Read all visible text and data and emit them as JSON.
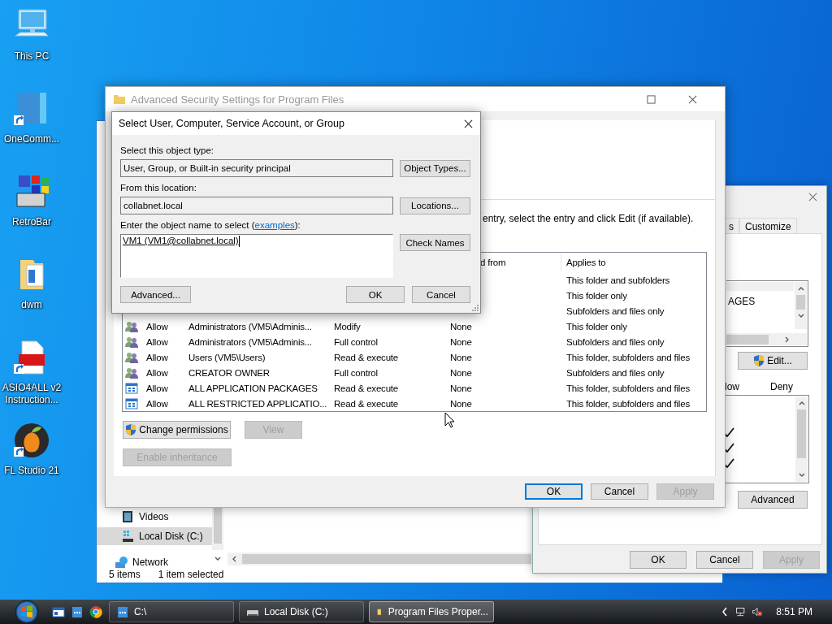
{
  "desktop_icons": [
    {
      "label": "This PC",
      "kind": "pc",
      "shortcut": false
    },
    {
      "label": "OneComm...",
      "kind": "one",
      "shortcut": true
    },
    {
      "label": "RetroBar",
      "kind": "retrobar",
      "shortcut": false
    },
    {
      "label": "dwm",
      "kind": "folder",
      "shortcut": false
    },
    {
      "label": "ASIO4ALL v2 Instruction...",
      "kind": "pdf",
      "shortcut": true
    },
    {
      "label": "FL Studio 21",
      "kind": "fl",
      "shortcut": true
    }
  ],
  "explorer": {
    "nav_items": [
      {
        "label": "Videos",
        "kind": "videos",
        "selected": false
      },
      {
        "label": "Local Disk (C:)",
        "kind": "disk",
        "selected": true
      },
      {
        "label": "Network",
        "kind": "network",
        "selected": false
      }
    ],
    "item_count": "5 items",
    "selection": "1 item selected"
  },
  "properties": {
    "tabs": [
      {
        "label": "s",
        "selected": false
      },
      {
        "label": "Customize",
        "selected": false
      }
    ],
    "group_item": "AGES",
    "edit_button": "Edit...",
    "permission_headers": {
      "allow": "low",
      "deny": "Deny"
    },
    "allow_checks": [
      {
        "checked": true
      },
      {
        "checked": true
      },
      {
        "checked": true
      }
    ],
    "advanced_button": "Advanced",
    "buttons": [
      {
        "label": "OK",
        "disabled": false
      },
      {
        "label": "Cancel",
        "disabled": false
      },
      {
        "label": "Apply",
        "disabled": true
      }
    ]
  },
  "advanced_security": {
    "title": "Advanced Security Settings for Program Files",
    "instruction": "entry, select the entry and click Edit (if available).",
    "headers": {
      "inherited": "d from",
      "applies_to": "Applies to"
    },
    "rows": [
      {
        "applies_to": "This folder and subfolders"
      },
      {
        "applies_to": "This folder only"
      },
      {
        "applies_to": "Subfolders and files only"
      },
      {
        "kind": "group",
        "type": "Allow",
        "principal": "Administrators (VM5\\Adminis...",
        "access": "Modify",
        "inherited": "None",
        "applies_to": "This folder only"
      },
      {
        "kind": "group",
        "type": "Allow",
        "principal": "Administrators (VM5\\Adminis...",
        "access": "Full control",
        "inherited": "None",
        "applies_to": "Subfolders and files only"
      },
      {
        "kind": "group",
        "type": "Allow",
        "principal": "Users (VM5\\Users)",
        "access": "Read & execute",
        "inherited": "None",
        "applies_to": "This folder, subfolders and files"
      },
      {
        "kind": "group",
        "type": "Allow",
        "principal": "CREATOR OWNER",
        "access": "Full control",
        "inherited": "None",
        "applies_to": "Subfolders and files only"
      },
      {
        "kind": "package",
        "type": "Allow",
        "principal": "ALL APPLICATION PACKAGES",
        "access": "Read & execute",
        "inherited": "None",
        "applies_to": "This folder, subfolders and files"
      },
      {
        "kind": "package",
        "type": "Allow",
        "principal": "ALL RESTRICTED APPLICATIO...",
        "access": "Read & execute",
        "inherited": "None",
        "applies_to": "This folder, subfolders and files"
      }
    ],
    "change_permissions": "Change permissions",
    "view": {
      "label": "View",
      "disabled": true
    },
    "enable_inheritance": {
      "label": "Enable inheritance",
      "disabled": true
    },
    "buttons": [
      {
        "label": "OK",
        "default": true,
        "disabled": false
      },
      {
        "label": "Cancel",
        "default": false,
        "disabled": false
      },
      {
        "label": "Apply",
        "default": false,
        "disabled": true
      }
    ]
  },
  "select_dialog": {
    "title": "Select User, Computer, Service Account, or Group",
    "object_type_label": "Select this object type:",
    "object_type": "User, Group, or Built-in security principal",
    "object_types_button": "Object Types...",
    "location_label": "From this location:",
    "location": "collabnet.local",
    "locations_button": "Locations...",
    "name_label": "Enter the object name to select (",
    "examples_link": "examples",
    "name_label_end": "):",
    "names_value": "VM1 (VM1@collabnet.local)",
    "check_names_button": "Check Names",
    "advanced_button": "Advanced...",
    "ok_button": "OK",
    "cancel_button": "Cancel"
  },
  "taskbar": {
    "quick_launch": [
      {
        "kind": "window"
      },
      {
        "kind": "explorer"
      },
      {
        "kind": "chrome"
      }
    ],
    "tasks": [
      {
        "label": "C:\\",
        "kind": "explorer",
        "active": false
      },
      {
        "label": "Local Disk (C:)",
        "kind": "disk",
        "active": false
      },
      {
        "label": "Program Files Proper...",
        "kind": "folder",
        "active": true
      }
    ],
    "volume_muted": true,
    "clock": "8:51 PM"
  }
}
